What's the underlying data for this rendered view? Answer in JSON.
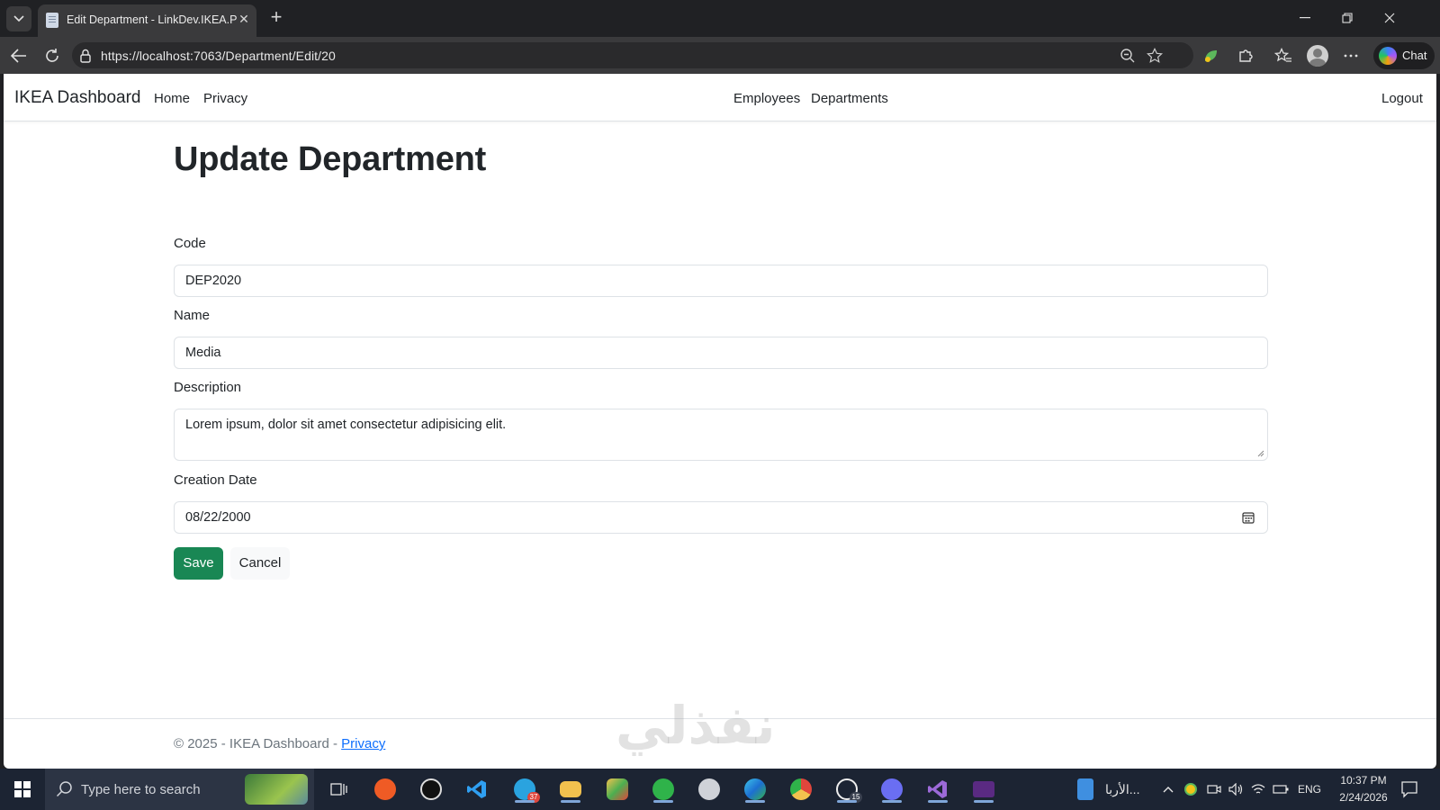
{
  "browser": {
    "tab_title": "Edit Department - LinkDev.IKEA.PL",
    "url": "https://localhost:7063/Department/Edit/20",
    "chat_label": "Chat"
  },
  "site": {
    "brand": "IKEA Dashboard",
    "nav_left": [
      "Home",
      "Privacy"
    ],
    "nav_center": [
      "Employees",
      "Departments"
    ],
    "nav_right": "Logout"
  },
  "form": {
    "title": "Update Department",
    "fields": [
      {
        "label": "Code",
        "value": "DEP2020"
      },
      {
        "label": "Name",
        "value": "Media"
      },
      {
        "label": "Description",
        "value": "Lorem ipsum, dolor sit amet consectetur adipisicing elit."
      },
      {
        "label": "Creation Date",
        "value": "08/22/2000"
      }
    ],
    "save_label": "Save",
    "cancel_label": "Cancel"
  },
  "footer": {
    "text": "© 2025 - IKEA Dashboard - ",
    "link": "Privacy"
  },
  "watermark": "نفذلي",
  "taskbar": {
    "search_placeholder": "Type here to search",
    "telegram_badge": "37",
    "whatsapp_badge": "15",
    "widget_label": "الأربا...",
    "language": "ENG",
    "time": "10:37 PM",
    "date": "2/24/2026"
  },
  "colors": {
    "save_button": "#198754",
    "link": "#0d6efd",
    "chrome_dark": "#202124"
  }
}
